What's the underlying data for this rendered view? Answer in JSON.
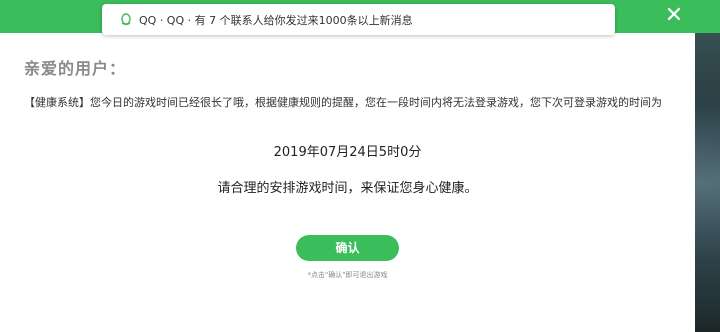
{
  "notification": {
    "text": "QQ · QQ · 有 7 个联系人给你发过来1000条以上新消息",
    "icon": "qq-penguin-icon"
  },
  "close": {
    "label": "✕",
    "icon": "close-icon"
  },
  "dialog": {
    "greeting": "亲爱的用户：",
    "message": "【健康系统】您今日的游戏时间已经很长了哦，根据健康规则的提醒，您在一段时间内将无法登录游戏，您下次可登录游戏的时间为",
    "unlock_time": "2019年07月24日5时0分",
    "advice": "请合理的安排游戏时间，来保证您身心健康。",
    "confirm_label": "确认",
    "hint": "*点击\"确认\"即可退出游戏"
  },
  "colors": {
    "accent": "#3cbd5c",
    "background": "#ffffff",
    "text": "#333333"
  }
}
